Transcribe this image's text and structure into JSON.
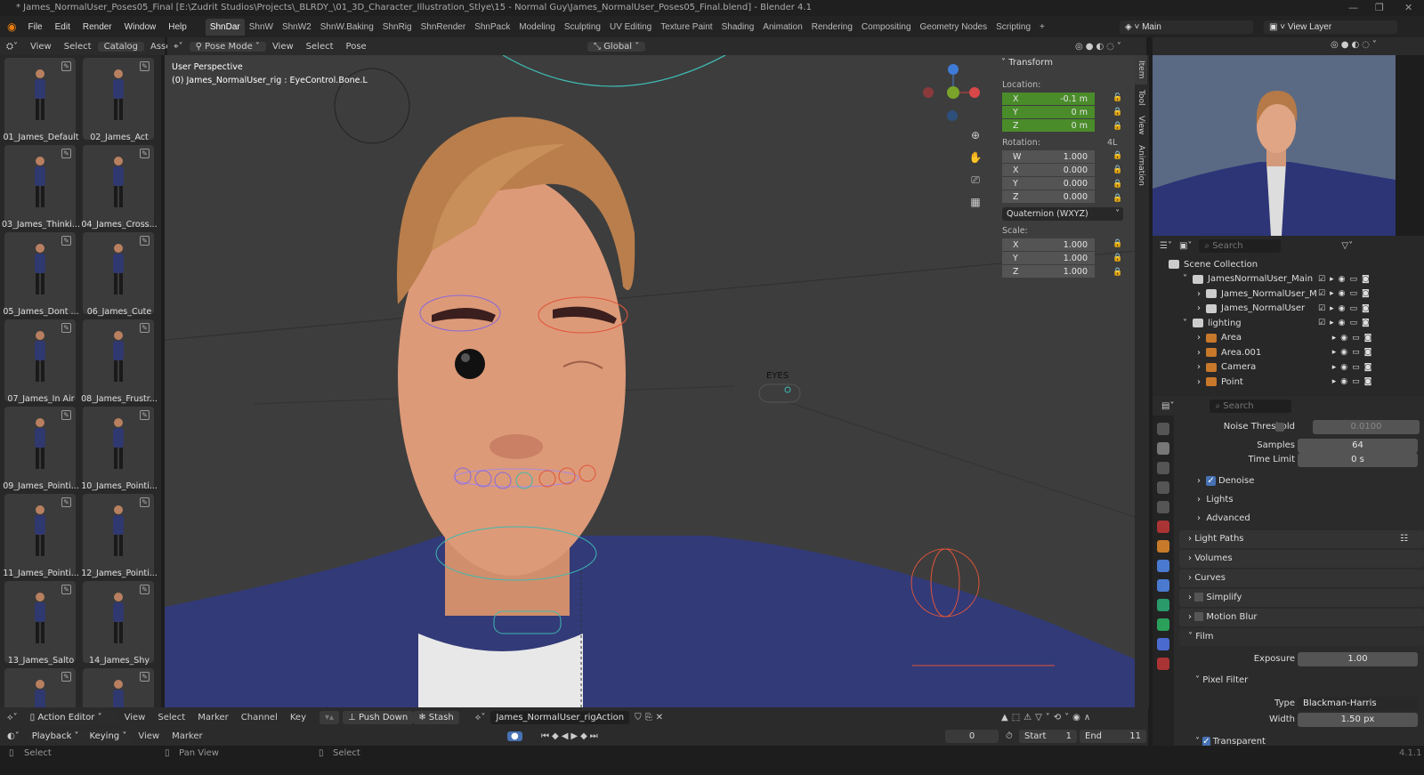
{
  "title": "* James_NormalUser_Poses05_Final [E:\\Zudrit Studios\\Projects\\_BLRDY_\\01_3D_Character_Illustration_Stlye\\15 - Normal Guy\\James_NormalUser_Poses05_Final.blend] - Blender 4.1",
  "menu": [
    "File",
    "Edit",
    "Render",
    "Window",
    "Help"
  ],
  "workspaces": [
    "ShnDar",
    "ShnW",
    "ShnW2",
    "ShnW.Baking",
    "ShnRig",
    "ShnRender",
    "ShnPack",
    "Modeling",
    "Sculpting",
    "UV Editing",
    "Texture Paint",
    "Shading",
    "Animation",
    "Rendering",
    "Compositing",
    "Geometry Nodes",
    "Scripting"
  ],
  "active_workspace": "ShnDar",
  "scene": "Main",
  "view_layer": "View Layer",
  "asset_header": {
    "items": [
      "View",
      "Select",
      "Catalog",
      "Asset"
    ]
  },
  "viewport_header": {
    "mode": "Pose Mode",
    "items": [
      "View",
      "Select",
      "Pose"
    ],
    "orientation": "Global"
  },
  "viewport": {
    "perspective": "User Perspective",
    "active": "(0) James_NormalUser_rig : EyeControl.Bone.L",
    "eyes_label": "EYES"
  },
  "assets": [
    "01_James_Default",
    "02_James_Act",
    "03_James_Thinki...",
    "04_James_Cross...",
    "05_James_Dont ...",
    "06_James_Cute",
    "07_James_In Air",
    "08_James_Frustr...",
    "09_James_Pointi...",
    "10_James_Pointi...",
    "11_James_Pointi...",
    "12_James_Pointi...",
    "13_James_Salto",
    "14_James_Shy",
    "",
    ""
  ],
  "transform": {
    "title": "Transform",
    "location_label": "Location:",
    "location": [
      {
        "axis": "X",
        "value": "-0.1 m"
      },
      {
        "axis": "Y",
        "value": "0 m"
      },
      {
        "axis": "Z",
        "value": "0 m"
      }
    ],
    "rotation_label": "Rotation:",
    "rotation_lock": "4L",
    "rotation": [
      {
        "axis": "W",
        "value": "1.000"
      },
      {
        "axis": "X",
        "value": "0.000"
      },
      {
        "axis": "Y",
        "value": "0.000"
      },
      {
        "axis": "Z",
        "value": "0.000"
      }
    ],
    "rotation_mode": "Quaternion (WXYZ)",
    "scale_label": "Scale:",
    "scale": [
      {
        "axis": "X",
        "value": "1.000"
      },
      {
        "axis": "Y",
        "value": "1.000"
      },
      {
        "axis": "Z",
        "value": "1.000"
      }
    ]
  },
  "side_tabs": [
    "Item",
    "Tool",
    "View",
    "Animation"
  ],
  "outliner": {
    "search_placeholder": "Search",
    "rows": [
      {
        "name": "Scene Collection",
        "indent": 0
      },
      {
        "name": "JamesNormalUser_Main",
        "indent": 1
      },
      {
        "name": "James_NormalUser_M",
        "indent": 2
      },
      {
        "name": "James_NormalUser",
        "indent": 2
      },
      {
        "name": "lighting",
        "indent": 1
      },
      {
        "name": "Area",
        "indent": 2
      },
      {
        "name": "Area.001",
        "indent": 2
      },
      {
        "name": "Camera",
        "indent": 2
      },
      {
        "name": "Point",
        "indent": 2
      }
    ]
  },
  "properties": {
    "search_placeholder": "Search",
    "noise_threshold": {
      "label": "Noise Threshold",
      "value": "0.0100"
    },
    "samples": {
      "label": "Samples",
      "value": "64"
    },
    "time_limit": {
      "label": "Time Limit",
      "value": "0 s"
    },
    "subpanels": [
      "Denoise",
      "Lights",
      "Advanced"
    ],
    "panels": [
      "Light Paths",
      "Volumes",
      "Curves",
      "Simplify",
      "Motion Blur"
    ],
    "film": "Film",
    "exposure": {
      "label": "Exposure",
      "value": "1.00"
    },
    "pixel_filter": "Pixel Filter",
    "type": {
      "label": "Type",
      "value": "Blackman-Harris"
    },
    "width": {
      "label": "Width",
      "value": "1.50 px"
    },
    "transparent": "Transparent"
  },
  "action_editor": {
    "mode": "Action Editor",
    "items": [
      "View",
      "Select",
      "Marker",
      "Channel",
      "Key"
    ],
    "push_down": "Push Down",
    "stash": "Stash",
    "action": "James_NormalUser_rigAction"
  },
  "timeline": {
    "items": [
      "Playback",
      "Keying",
      "View",
      "Marker"
    ],
    "current_frame": "0",
    "start_label": "Start",
    "start": "1",
    "end_label": "End",
    "end": "11"
  },
  "status": {
    "left": "Select",
    "middle": "Pan View",
    "right": "Select",
    "version": "4.1.1"
  },
  "colors": {
    "accent": "#4772b3",
    "green_field": "#4a8c2a",
    "viewport": "#3d3d3d"
  }
}
